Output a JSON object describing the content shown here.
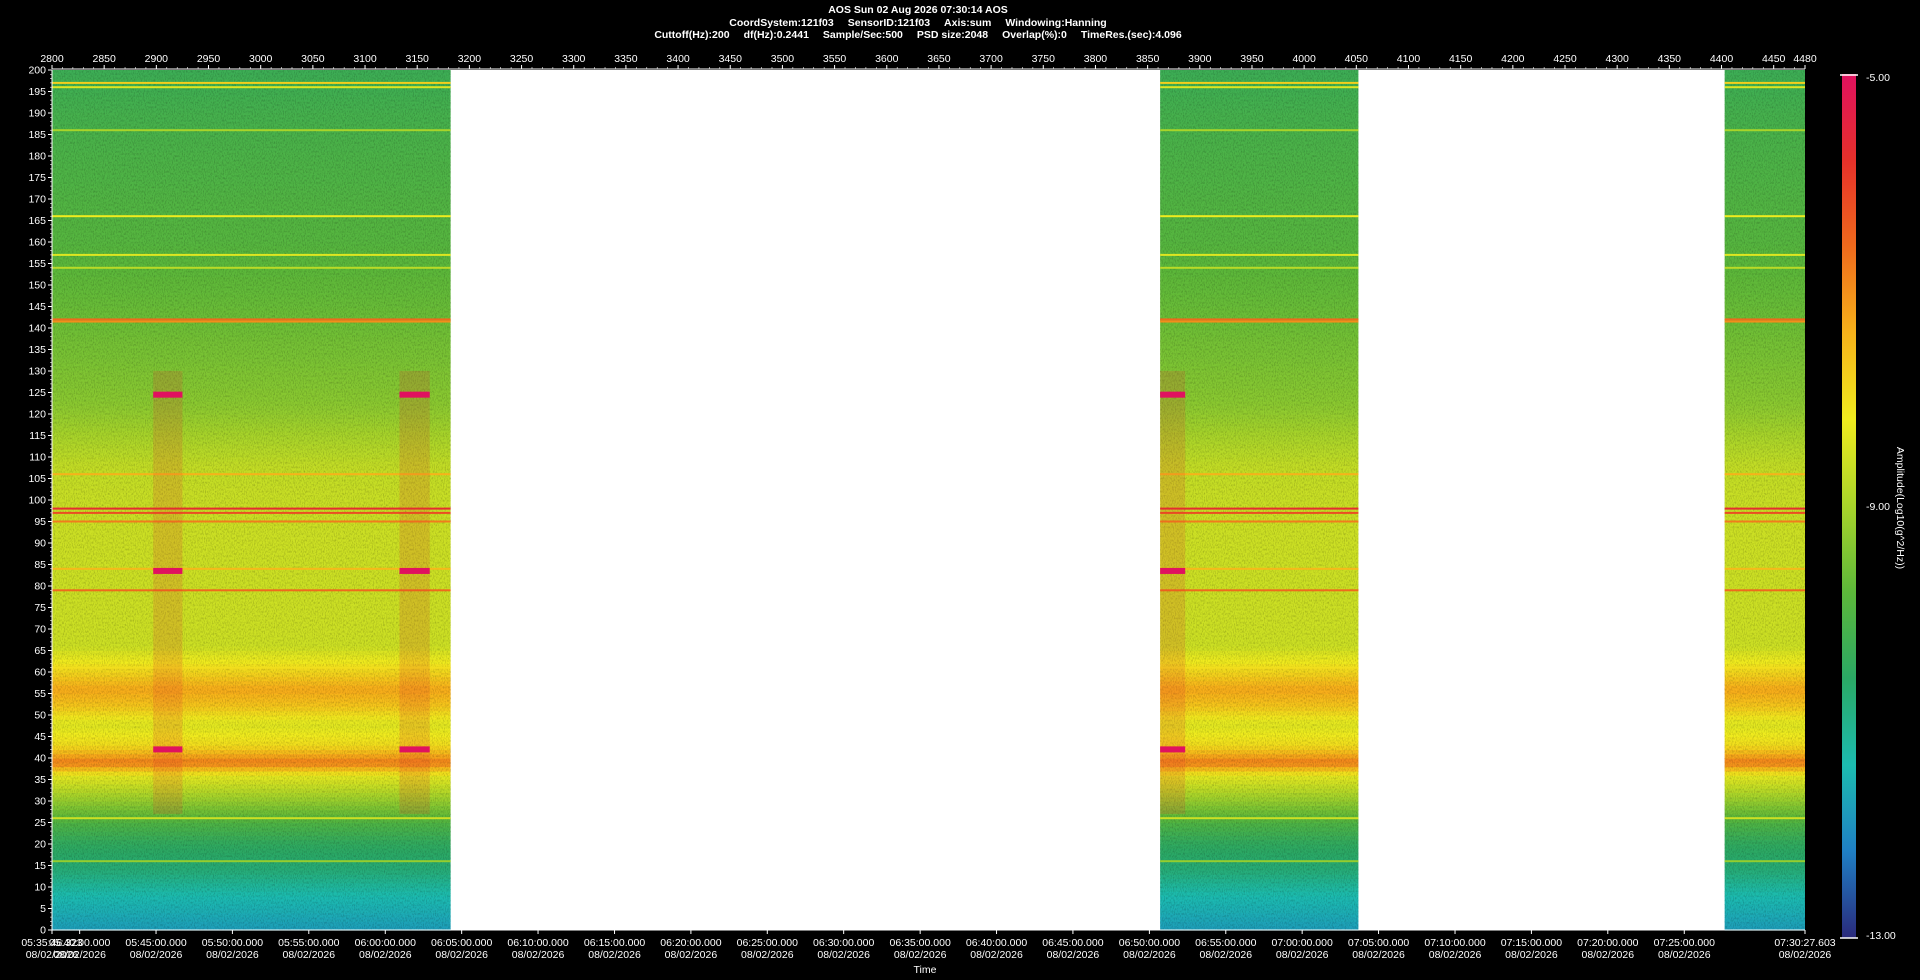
{
  "header": {
    "line1": "AOS  Sun 02 Aug 2026 07:30:14  AOS",
    "line2_parts": [
      "CoordSystem:121f03",
      "SensorID:121f03",
      "Axis:sum",
      "Windowing:Hanning"
    ],
    "line3_parts": [
      "Cuttoff(Hz):200",
      "df(Hz):0.2441",
      "Sample/Sec:500",
      "PSD size:2048",
      "Overlap(%):0",
      "TimeRes.(sec):4.096"
    ]
  },
  "colors": {
    "background": "#000000",
    "no_data": "#ffffff",
    "colormap": [
      "#2a2a7c",
      "#1f7fc4",
      "#1cbcb0",
      "#2aa865",
      "#5cb83a",
      "#a8d42a",
      "#f0ec1e",
      "#f7b21a",
      "#ef6a1c",
      "#e6302a",
      "#e0115f"
    ]
  },
  "chart_data": {
    "type": "heatmap",
    "title": "AOS  Sun 02 Aug 2026 07:30:14  AOS",
    "xlabel": "Time",
    "ylabel": "",
    "colorbar_label": "Amplitude(Log10(g^2/Hz))",
    "colorbar_range": [
      -13.0,
      -5.0
    ],
    "colorbar_ticks": [
      "-5.00",
      "-9.00",
      "-13.00"
    ],
    "y_range": [
      0,
      200
    ],
    "y_ticks": [
      0,
      5,
      10,
      15,
      20,
      25,
      30,
      35,
      40,
      45,
      50,
      55,
      60,
      65,
      70,
      75,
      80,
      85,
      90,
      95,
      100,
      105,
      110,
      115,
      120,
      125,
      130,
      135,
      140,
      145,
      150,
      155,
      160,
      165,
      170,
      175,
      180,
      185,
      190,
      195,
      200
    ],
    "x_top_range": [
      2800,
      4480
    ],
    "x_top_ticks": [
      2800,
      2850,
      2900,
      2950,
      3000,
      3050,
      3100,
      3150,
      3200,
      3250,
      3300,
      3350,
      3400,
      3450,
      3500,
      3550,
      3600,
      3650,
      3700,
      3750,
      3800,
      3850,
      3900,
      3950,
      4000,
      4050,
      4100,
      4150,
      4200,
      4250,
      4300,
      4350,
      4400,
      4450,
      4480
    ],
    "x_bottom_ticks": [
      {
        "x": 2800,
        "time": "05:35:46.323",
        "date": "08/02/2026"
      },
      {
        "x": 2826.5,
        "time": "05:40:00.000",
        "date": "08/02/2026"
      },
      {
        "x": 2899.7,
        "time": "05:45:00.000",
        "date": "08/02/2026"
      },
      {
        "x": 2972.9,
        "time": "05:50:00.000",
        "date": "08/02/2026"
      },
      {
        "x": 3046.1,
        "time": "05:55:00.000",
        "date": "08/02/2026"
      },
      {
        "x": 3119.4,
        "time": "06:00:00.000",
        "date": "08/02/2026"
      },
      {
        "x": 3192.6,
        "time": "06:05:00.000",
        "date": "08/02/2026"
      },
      {
        "x": 3265.8,
        "time": "06:10:00.000",
        "date": "08/02/2026"
      },
      {
        "x": 3339.1,
        "time": "06:15:00.000",
        "date": "08/02/2026"
      },
      {
        "x": 3412.3,
        "time": "06:20:00.000",
        "date": "08/02/2026"
      },
      {
        "x": 3485.5,
        "time": "06:25:00.000",
        "date": "08/02/2026"
      },
      {
        "x": 3558.7,
        "time": "06:30:00.000",
        "date": "08/02/2026"
      },
      {
        "x": 3632.0,
        "time": "06:35:00.000",
        "date": "08/02/2026"
      },
      {
        "x": 3705.2,
        "time": "06:40:00.000",
        "date": "08/02/2026"
      },
      {
        "x": 3778.4,
        "time": "06:45:00.000",
        "date": "08/02/2026"
      },
      {
        "x": 3851.7,
        "time": "06:50:00.000",
        "date": "08/02/2026"
      },
      {
        "x": 3924.9,
        "time": "06:55:00.000",
        "date": "08/02/2026"
      },
      {
        "x": 3998.1,
        "time": "07:00:00.000",
        "date": "08/02/2026"
      },
      {
        "x": 4071.3,
        "time": "07:05:00.000",
        "date": "08/02/2026"
      },
      {
        "x": 4144.6,
        "time": "07:10:00.000",
        "date": "08/02/2026"
      },
      {
        "x": 4217.8,
        "time": "07:15:00.000",
        "date": "08/02/2026"
      },
      {
        "x": 4291.0,
        "time": "07:20:00.000",
        "date": "08/02/2026"
      },
      {
        "x": 4364.3,
        "time": "07:25:00.000",
        "date": "08/02/2026"
      },
      {
        "x": 4480,
        "time": "07:30:27.603",
        "date": "08/02/2026"
      }
    ],
    "data_segments": [
      {
        "x_start": 2800,
        "x_end": 3182
      },
      {
        "x_start": 3862,
        "x_end": 4052
      },
      {
        "x_start": 4403,
        "x_end": 4480
      }
    ],
    "background_level_by_freq": [
      {
        "hz": 0,
        "level": -11.8
      },
      {
        "hz": 8,
        "level": -11.4
      },
      {
        "hz": 14,
        "level": -10.8
      },
      {
        "hz": 20,
        "level": -10.5
      },
      {
        "hz": 25,
        "level": -10.0
      },
      {
        "hz": 30,
        "level": -9.2
      },
      {
        "hz": 36,
        "level": -8.3
      },
      {
        "hz": 39,
        "level": -6.8
      },
      {
        "hz": 43,
        "level": -8.0
      },
      {
        "hz": 48,
        "level": -8.4
      },
      {
        "hz": 52,
        "level": -7.7
      },
      {
        "hz": 56,
        "level": -7.3
      },
      {
        "hz": 60,
        "level": -7.9
      },
      {
        "hz": 66,
        "level": -8.6
      },
      {
        "hz": 80,
        "level": -8.6
      },
      {
        "hz": 95,
        "level": -8.6
      },
      {
        "hz": 108,
        "level": -8.7
      },
      {
        "hz": 122,
        "level": -9.3
      },
      {
        "hz": 140,
        "level": -9.6
      },
      {
        "hz": 160,
        "level": -9.9
      },
      {
        "hz": 185,
        "level": -10.1
      },
      {
        "hz": 200,
        "level": -10.3
      }
    ],
    "tonal_lines_hz": [
      {
        "hz": 197,
        "level": -7.8
      },
      {
        "hz": 196,
        "level": -8.4
      },
      {
        "hz": 186,
        "level": -9.0
      },
      {
        "hz": 166,
        "level": -8.2
      },
      {
        "hz": 157,
        "level": -8.4
      },
      {
        "hz": 154,
        "level": -8.8
      },
      {
        "hz": 142,
        "level": -6.6
      },
      {
        "hz": 141.5,
        "level": -7.0
      },
      {
        "hz": 106,
        "level": -7.4
      },
      {
        "hz": 98,
        "level": -5.7
      },
      {
        "hz": 97,
        "level": -6.2
      },
      {
        "hz": 95,
        "level": -6.8
      },
      {
        "hz": 84,
        "level": -7.5
      },
      {
        "hz": 79,
        "level": -6.6
      },
      {
        "hz": 61,
        "level": -8.0
      },
      {
        "hz": 26,
        "level": -8.6
      },
      {
        "hz": 16,
        "level": -9.2
      }
    ],
    "transient_events": [
      {
        "x_start": 2897,
        "x_end": 2925,
        "bands_hz": [
          124.5,
          83.5,
          42
        ]
      },
      {
        "x_start": 3133,
        "x_end": 3162,
        "bands_hz": [
          124.5,
          83.5,
          42
        ]
      },
      {
        "x_start": 3862,
        "x_end": 3886,
        "bands_hz": [
          124.5,
          83.5,
          42
        ]
      }
    ]
  }
}
